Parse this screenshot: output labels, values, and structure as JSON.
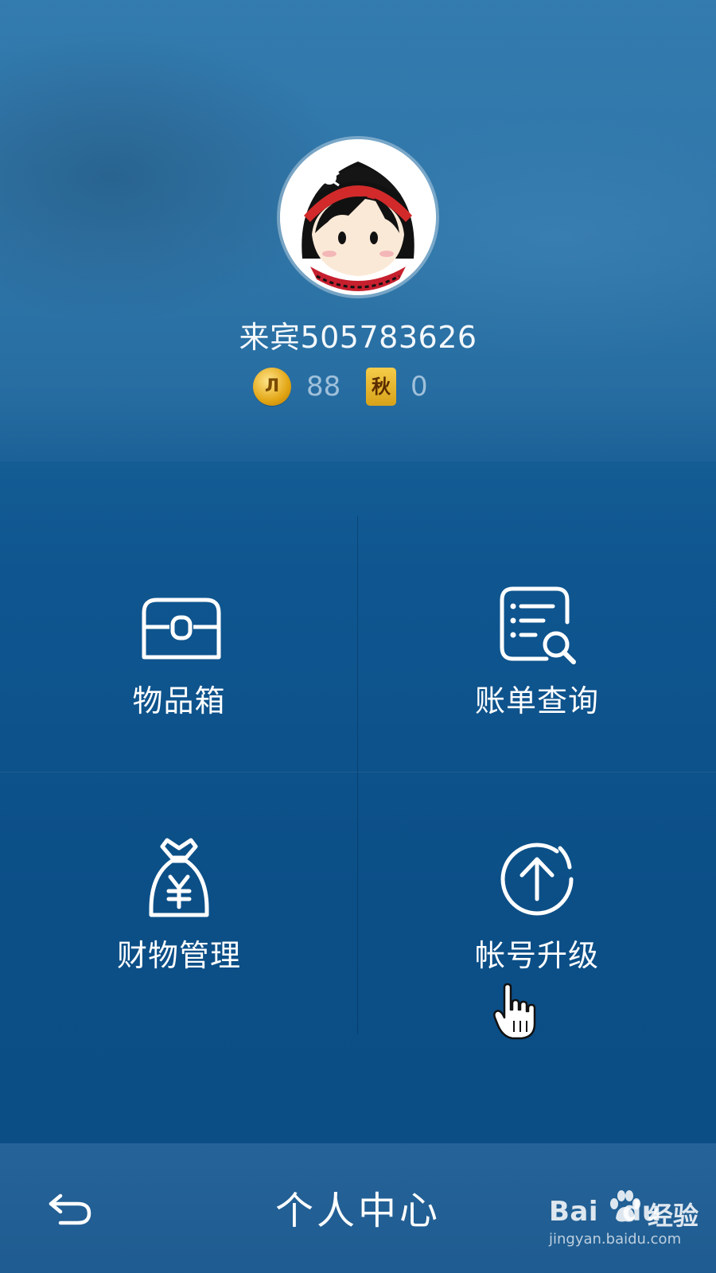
{
  "profile": {
    "username": "来宾505783626",
    "coin_symbol": "Л",
    "coin_count": "88",
    "autumn_badge": "秋",
    "autumn_count": "0"
  },
  "menu": {
    "items": [
      {
        "label": "物品箱",
        "icon": "treasure-box-icon"
      },
      {
        "label": "账单查询",
        "icon": "bill-search-icon"
      },
      {
        "label": "财物管理",
        "icon": "money-bag-icon"
      },
      {
        "label": "帐号升级",
        "icon": "upgrade-arrow-icon"
      }
    ]
  },
  "bottom_bar": {
    "title": "个人中心",
    "back_icon": "back-arrow-icon"
  },
  "watermark": {
    "brand_left": "Bai",
    "brand_right": "du",
    "brand_cn": "经验",
    "url": "jingyan.baidu.com"
  },
  "colors": {
    "background_top": "#2f79ad",
    "background_bottom": "#0a4c84",
    "text": "#ffffff",
    "muted_text": "#9fc0da",
    "coin_gold": "#e2a514"
  }
}
